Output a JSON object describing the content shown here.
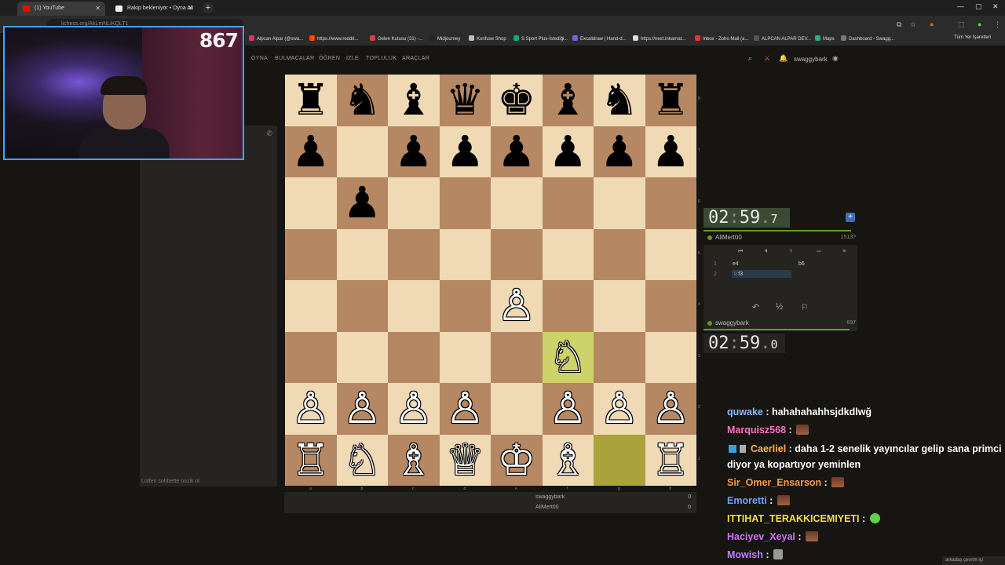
{
  "browser": {
    "tabs": [
      {
        "title": "(1) YouTube",
        "icon": "youtube-icon",
        "color": "#ff0000"
      },
      {
        "title": "Rakip bekleniyor • Oyna Ali",
        "icon": "lichess-icon",
        "color": "#ffffff"
      }
    ],
    "url": "lichess.org/AkLmNLiKQLT1",
    "bookmarks": [
      "Alpcan Alpar (@swa...",
      "https://www.reddit...",
      "Gelen Kutusu (31) -...",
      "Midjourney",
      "Konfuse Shop",
      "S Sport Plus-İstediği...",
      "Excalidraw | Hand-d...",
      "https://next.inkarnat...",
      "Inbox - Zoho Mail (a...",
      "ALPCAN ALPAR DEV...",
      "Maps",
      "Dashboard - Swagg..."
    ],
    "all_bookmarks": "Tüm Yer İşaretleri"
  },
  "site": {
    "nav": [
      "OYNA",
      "BULMACALAR",
      "ÖĞREN",
      "İZLE",
      "TOPLULUK",
      "ARAÇLAR"
    ],
    "username": "swaggybark"
  },
  "webcam": {
    "counter": "867"
  },
  "chat": {
    "hint": "Lütfen sohbette nazik ol"
  },
  "board": {
    "files": [
      "a",
      "b",
      "c",
      "d",
      "e",
      "f",
      "g",
      "h"
    ],
    "ranks": [
      "8",
      "7",
      "6",
      "5",
      "4",
      "3",
      "2",
      "1"
    ],
    "rows": [
      [
        "♜",
        "♞",
        "♝",
        "♛",
        "♚",
        "♝",
        "♞",
        "♜"
      ],
      [
        "♟",
        "",
        "♟",
        "♟",
        "♟",
        "♟",
        "♟",
        "♟"
      ],
      [
        "",
        "♟",
        "",
        "",
        "",
        "",
        "",
        ""
      ],
      [
        "",
        "",
        "",
        "",
        "",
        "",
        "",
        ""
      ],
      [
        "",
        "",
        "",
        "",
        "♙",
        "",
        "",
        ""
      ],
      [
        "",
        "",
        "",
        "",
        "",
        "♘",
        "",
        ""
      ],
      [
        "♙",
        "♙",
        "♙",
        "♙",
        "",
        "♙",
        "♙",
        "♙"
      ],
      [
        "♖",
        "♘",
        "♗",
        "♕",
        "♔",
        "♗",
        "",
        ""
      ]
    ],
    "white_rook_h1": "♖",
    "highlight": {
      "from": "g1",
      "to": "f3"
    }
  },
  "score": [
    {
      "name": "swaggybark",
      "value": "0"
    },
    {
      "name": "AliMert00",
      "value": "0"
    }
  ],
  "clocks": {
    "top": {
      "min": "02",
      "sec": "59",
      "tenth": "7"
    },
    "bottom": {
      "min": "02",
      "sec": "59",
      "tenth": "0"
    }
  },
  "players": {
    "top": {
      "name": "AliMert00",
      "rating": "1513?"
    },
    "bottom": {
      "name": "swaggybark",
      "rating": "697"
    }
  },
  "moves": [
    {
      "num": "1",
      "white": "e4",
      "black": "b6"
    },
    {
      "num": "2",
      "white": "♘f3",
      "black": ""
    }
  ],
  "twitch_chat": [
    {
      "user": "quwake",
      "color": "#8fb7ff",
      "text": "hahahahahhsjdkdlwğ",
      "emote": ""
    },
    {
      "user": "Marquisz568",
      "color": "#ff6fc0",
      "text": "",
      "emote": "brick"
    },
    {
      "user": "Caerliel",
      "color": "#ffb347",
      "text": "daha 1-2 senelik yayıncılar gelip sana primci",
      "emote": ""
    },
    {
      "user": "",
      "color": "#ffffff",
      "text": "diyor ya kopartıyor yeminlen",
      "emote": ""
    },
    {
      "user": "Sir_Omer_Ensarson",
      "color": "#ff9a3c",
      "text": "",
      "emote": "brick"
    },
    {
      "user": "Emoretti",
      "color": "#6fa0ff",
      "text": "",
      "emote": "brick"
    },
    {
      "user": "ITTIHAT_TERAKKICEMIYETI",
      "color": "#f0e040",
      "text": "",
      "emote": "green"
    },
    {
      "user": "Haciyev_Xeyal",
      "color": "#d070ff",
      "text": "",
      "emote": "brick"
    },
    {
      "user": "Mowish",
      "color": "#c080ff",
      "text": "",
      "emote": "small"
    }
  ],
  "friends_online": "arkadaş çevrim içi"
}
